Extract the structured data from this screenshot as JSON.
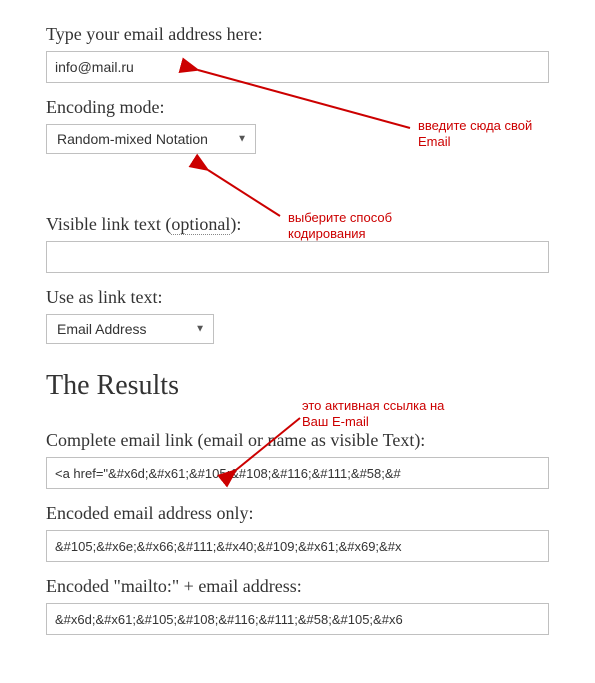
{
  "email": {
    "label": "Type your email address here:",
    "value": "info@mail.ru"
  },
  "encoding": {
    "label": "Encoding mode:",
    "selected": "Random-mixed Notation"
  },
  "visible_text": {
    "label_pre": "Visible link text (",
    "label_opt": "optional",
    "label_post": "):",
    "value": ""
  },
  "linktext": {
    "label": "Use as link text:",
    "selected": "Email Address"
  },
  "results": {
    "heading": "The Results",
    "complete": {
      "label": "Complete email link (email or name as visible Text):",
      "value": "<a href=\"&#x6d;&#x61;&#105;&#108;&#116;&#111;&#58;&#"
    },
    "encoded_only": {
      "label": "Encoded email address only:",
      "value": "&#105;&#x6e;&#x66;&#111;&#x40;&#109;&#x61;&#x69;&#x"
    },
    "encoded_mailto": {
      "label": "Encoded \"mailto:\" + email address:",
      "value": "&#x6d;&#x61;&#105;&#108;&#116;&#111;&#58;&#105;&#x6"
    }
  },
  "annotations": {
    "enter_email": "введите сюда свой\nEmail",
    "choose_encoding": "выберите способ\nкодирования",
    "active_link": "это активная ссылка на\nВаш E-mail"
  },
  "colors": {
    "annotation_red": "#cc0000",
    "text": "#333333",
    "border": "#c0c0c0"
  }
}
